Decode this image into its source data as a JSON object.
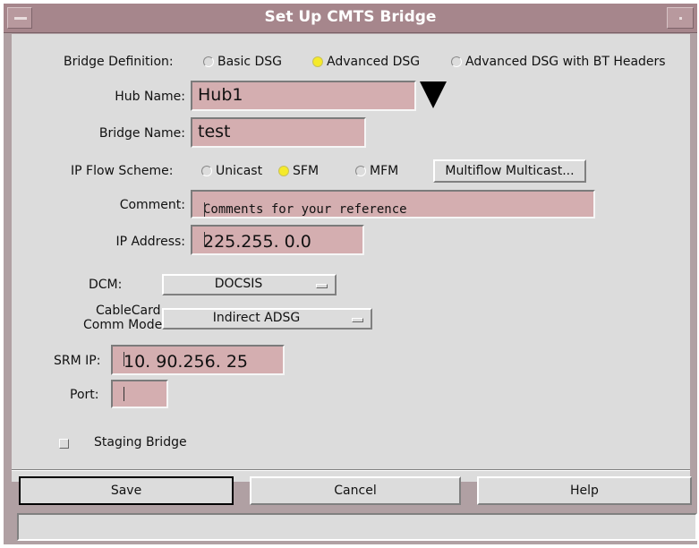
{
  "window": {
    "title": "Set Up CMTS Bridge"
  },
  "bridge_definition": {
    "label": "Bridge Definition:",
    "options": [
      "Basic DSG",
      "Advanced DSG",
      "Advanced DSG with BT Headers"
    ],
    "selected": "Advanced DSG"
  },
  "hub_name": {
    "label": "Hub Name:",
    "value": "Hub1"
  },
  "bridge_name": {
    "label": "Bridge Name:",
    "value": "test"
  },
  "ip_flow_scheme": {
    "label": "IP Flow Scheme:",
    "options": [
      "Unicast",
      "SFM",
      "MFM"
    ],
    "selected": "SFM",
    "multiflow_button": "Multiflow Multicast..."
  },
  "comment": {
    "label": "Comment:",
    "value": "Comments for your reference"
  },
  "ip_address": {
    "label": "IP Address:",
    "value": "225.255. 0.0"
  },
  "dcm": {
    "label": "DCM:",
    "value": "DOCSIS"
  },
  "cablecard": {
    "label_line1": "CableCard",
    "label_line2": "Comm Mode:",
    "value": "Indirect ADSG"
  },
  "srm_ip": {
    "label": "SRM IP:",
    "value": "10. 90.256. 25"
  },
  "port": {
    "label": "Port:",
    "value": ""
  },
  "staging_bridge": {
    "label": "Staging Bridge",
    "checked": false
  },
  "buttons": {
    "save": "Save",
    "cancel": "Cancel",
    "help": "Help"
  },
  "status": {
    "text": ""
  },
  "colors": {
    "title_bar": "#a6868c",
    "field_bg": "#d4aeb0",
    "dialog_bg": "#dcdcdc",
    "radio_selected": "#f5ea2a"
  }
}
